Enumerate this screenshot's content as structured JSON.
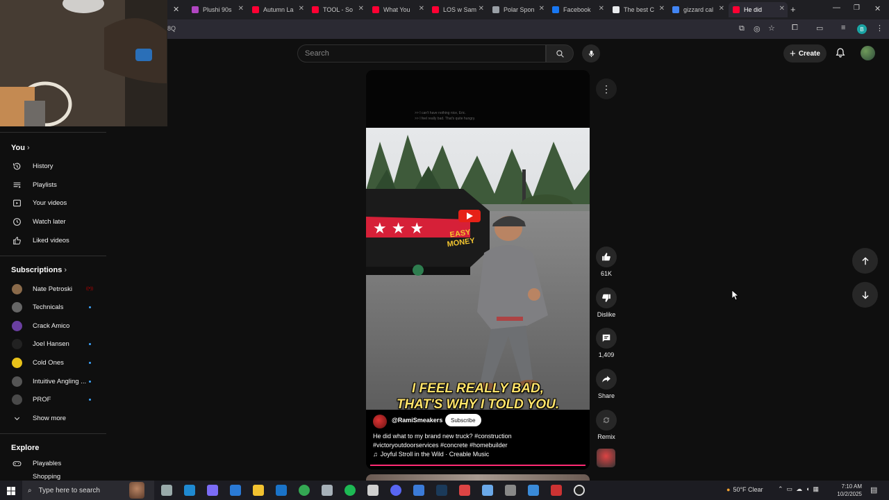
{
  "browser": {
    "tabs": [
      {
        "title": "Plushi 90s",
        "color": "#b146c2"
      },
      {
        "title": "Autumn La",
        "color": "#ff0033"
      },
      {
        "title": "TOOL - So",
        "color": "#ff0033"
      },
      {
        "title": "What You",
        "color": "#ff0033"
      },
      {
        "title": "LOS w Sam",
        "color": "#ff0033"
      },
      {
        "title": "Polar Spon",
        "color": "#9aa0a6"
      },
      {
        "title": "Facebook",
        "color": "#1877f2"
      },
      {
        "title": "The best C",
        "color": "#e8eaed"
      },
      {
        "title": "gizzard cal",
        "color": "#4285f4"
      },
      {
        "title": "He did",
        "color": "#ff0033"
      }
    ],
    "url_fragment": "8Q",
    "profile_initial": "B"
  },
  "header": {
    "search_placeholder": "Search",
    "create_label": "Create"
  },
  "sidebar": {
    "you": {
      "title": "You",
      "items": [
        {
          "label": "History",
          "icon": "history-icon"
        },
        {
          "label": "Playlists",
          "icon": "playlists-icon"
        },
        {
          "label": "Your videos",
          "icon": "your-videos-icon"
        },
        {
          "label": "Watch later",
          "icon": "watch-later-icon"
        },
        {
          "label": "Liked videos",
          "icon": "liked-videos-icon"
        }
      ]
    },
    "subscriptions": {
      "title": "Subscriptions",
      "channels": [
        {
          "name": "Nate Petroski",
          "avatar_color": "#8a6a4a",
          "indicator": "live"
        },
        {
          "name": "Technicals",
          "avatar_color": "#666666",
          "indicator": "dot"
        },
        {
          "name": "Crack Amico",
          "avatar_color": "#6a3fa0",
          "indicator": "none"
        },
        {
          "name": "Joel Hansen",
          "avatar_color": "#222222",
          "indicator": "dot"
        },
        {
          "name": "Cold Ones",
          "avatar_color": "#e8c21a",
          "indicator": "dot"
        },
        {
          "name": "Intuitive Angling ...",
          "avatar_color": "#555555",
          "indicator": "dot"
        },
        {
          "name": "PROF",
          "avatar_color": "#4a4a4a",
          "indicator": "dot"
        }
      ],
      "show_more": "Show more"
    },
    "explore": {
      "title": "Explore",
      "items": [
        {
          "label": "Playables",
          "icon": "playables-icon"
        },
        {
          "label": "Shopping",
          "icon": "shopping-icon"
        }
      ]
    }
  },
  "short": {
    "cc_lines": [
      ">> I can't have nothing nice, Eric.",
      ">> I feel really bad. That's quite hungry."
    ],
    "trailer_text": "EASY MONEY",
    "caption_line1": "I FEEL REALLY BAD,",
    "caption_line2": "THAT'S WHY I TOLD YOU.",
    "channel": "@RamiSmeakers",
    "subscribe_label": "Subscribe",
    "description_line1": "He did what to my brand new truck? #construction",
    "description_line2": "#victoryoutdoorservices #concrete #homebuilder",
    "music": "Joyful Stroll in the Wild · Creable Music",
    "progress": 1.0
  },
  "actions": {
    "likes": "61K",
    "dislike": "Dislike",
    "comments": "1,409",
    "share": "Share",
    "remix": "Remix"
  },
  "taskbar": {
    "search_placeholder": "Type here to search",
    "weather": "50°F  Clear",
    "time": "7:10 AM",
    "date": "10/2/2025"
  }
}
